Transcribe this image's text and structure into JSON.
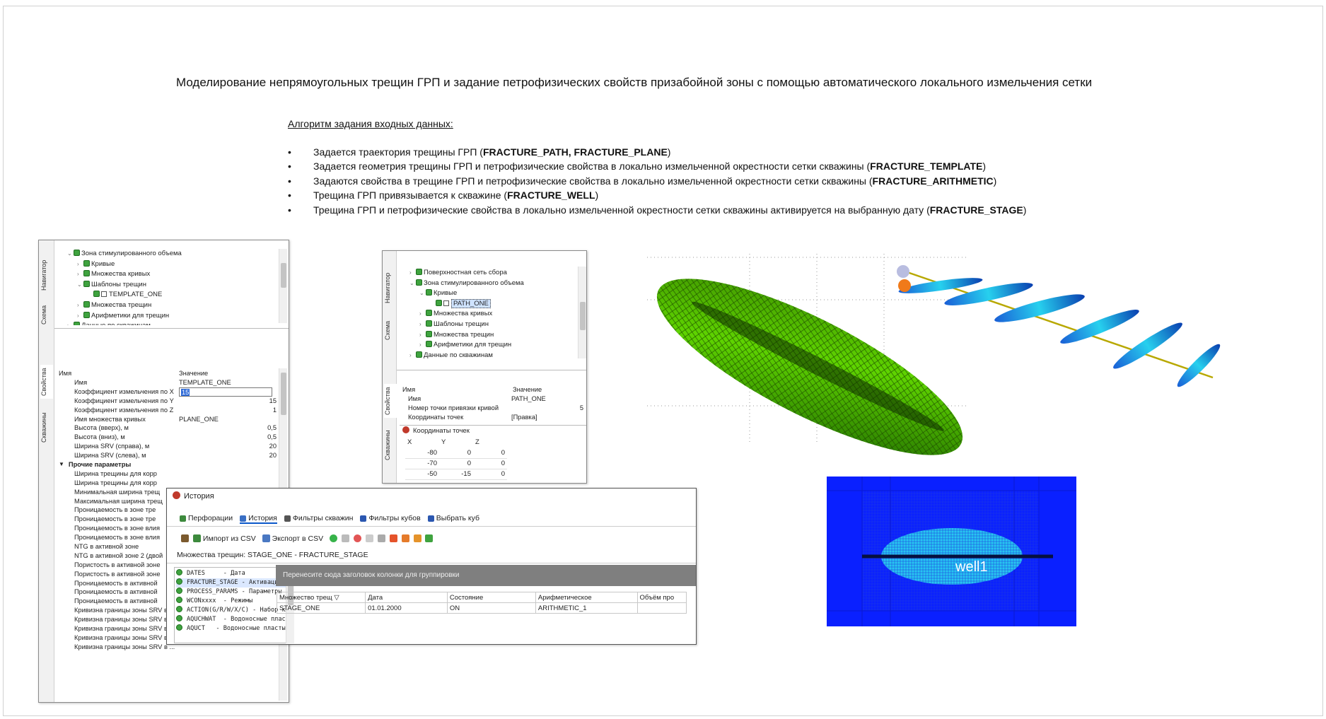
{
  "header": {
    "title": "Моделирование непрямоугольных трещин ГРП и задание петрофизических свойств призабойной зоны с помощью автоматического локального измельчения сетки",
    "algo_title": "Алгоритм задания входных данных:",
    "bullets": [
      {
        "text": "Задается траектория трещины ГРП (",
        "bold": "FRACTURE_PATH, FRACTURE_PLANE",
        "end": ")"
      },
      {
        "text": "Задается геометрия трещины ГРП и петрофизические свойства в локально измельченной окрестности сетки скважины  (",
        "bold": "FRACTURE_TEMPLATE",
        "end": ")"
      },
      {
        "text": "Задаются свойства в трещине ГРП и петрофизические свойства в локально измельченной окрестности сетки скважины  (",
        "bold": "FRACTURE_ARITHMETIC",
        "end": ")"
      },
      {
        "text": "Трещина ГРП привязывается к скважине (",
        "bold": "FRACTURE_WELL",
        "end": ")"
      },
      {
        "text": "Трещина ГРП и петрофизические свойства в локально измельченной окрестности сетки скважины активируется на выбранную дату (",
        "bold": "FRACTURE_STAGE",
        "end": ")"
      }
    ]
  },
  "win1": {
    "tabs": {
      "navigator": "Навигатор",
      "schema": "Схема",
      "props": "Свойства",
      "wells": "Скважины"
    },
    "tree": [
      {
        "label": "Зона стимулированного объема",
        "level": 0,
        "arrow": "⌄"
      },
      {
        "label": "Кривые",
        "level": 1,
        "arrow": "›"
      },
      {
        "label": "Множества кривых",
        "level": 1,
        "arrow": "›"
      },
      {
        "label": "Шаблоны трещин",
        "level": 1,
        "arrow": "⌄"
      },
      {
        "label": "TEMPLATE_ONE",
        "level": 2,
        "arrow": "",
        "check": true
      },
      {
        "label": "Множества трещин",
        "level": 1,
        "arrow": "›"
      },
      {
        "label": "Арифметики для трещин",
        "level": 1,
        "arrow": "›"
      },
      {
        "label": "Данные по скважинам",
        "level": 0,
        "arrow": "›"
      }
    ],
    "col_name": "Имя",
    "col_value": "Значение",
    "props": [
      {
        "n": "Имя",
        "v": "TEMPLATE_ONE",
        "r": false
      },
      {
        "n": "Коэффициент измельчения по X",
        "v": "15",
        "r": false,
        "edit": true
      },
      {
        "n": "Коэффициент измельчения по Y",
        "v": "15",
        "r": true
      },
      {
        "n": "Коэффициент измельчения по Z",
        "v": "1",
        "r": true
      },
      {
        "n": "Имя множества кривых",
        "v": "PLANE_ONE",
        "r": false
      },
      {
        "n": "Высота (вверх), м",
        "v": "0,5",
        "r": true
      },
      {
        "n": "Высота (вниз), м",
        "v": "0,5",
        "r": true
      },
      {
        "n": "Ширина SRV (справа), м",
        "v": "20",
        "r": true
      },
      {
        "n": "Ширина SRV (слева), м",
        "v": "20",
        "r": true
      }
    ],
    "group_label": "Прочие параметры",
    "other": [
      "Ширина трещины для корр",
      "Ширина трещины для корр",
      "Минимальная ширина трещ",
      "Максимальная ширина трещ",
      "Проницаемость в зоне тре",
      "Проницаемость в зоне тре",
      "Проницаемость в зоне влия",
      "Проницаемость в зоне влия",
      "NTG в активной зоне",
      "NTG в активной зоне 2 (двой",
      "Пористость в активной зоне",
      "Пористость в активной зоне",
      "Проницаемость в активной",
      "Проницаемость в активной",
      "Проницаемость в активной",
      "Кривизна границы зоны SRV в ...",
      "Кривизна границы зоны SRV в ...",
      "Кривизна границы зоны SRV в ...",
      "Кривизна границы зоны SRV в ...",
      "Кривизна границы зоны SRV в ..."
    ]
  },
  "win2": {
    "tabs": {
      "navigator": "Навигатор",
      "schema": "Схема",
      "props": "Свойства",
      "wells": "Скважины"
    },
    "tree": [
      {
        "label": "Поверхностная сеть сбора",
        "level": 0,
        "arrow": "›"
      },
      {
        "label": "Зона стимулированного объема",
        "level": 0,
        "arrow": "⌄"
      },
      {
        "label": "Кривые",
        "level": 1,
        "arrow": "⌄"
      },
      {
        "label": "PATH_ONE",
        "level": 2,
        "arrow": "",
        "check": true,
        "sel": true
      },
      {
        "label": "Множества кривых",
        "level": 1,
        "arrow": "›"
      },
      {
        "label": "Шаблоны трещин",
        "level": 1,
        "arrow": "›"
      },
      {
        "label": "Множества трещин",
        "level": 1,
        "arrow": "›"
      },
      {
        "label": "Арифметики для трещин",
        "level": 1,
        "arrow": "›"
      },
      {
        "label": "Данные по скважинам",
        "level": 0,
        "arrow": "›"
      }
    ],
    "col_name": "Имя",
    "col_value": "Значение",
    "props": [
      {
        "n": "Имя",
        "v": "PATH_ONE",
        "r": false
      },
      {
        "n": "Номер точки привязки кривой",
        "v": "5",
        "r": true
      },
      {
        "n": "Координаты точек",
        "v": "[Правка]",
        "r": false
      }
    ],
    "coords_title": "Координаты точек",
    "coords_head": [
      "X",
      "Y",
      "Z"
    ],
    "coords": [
      [
        "-80",
        "0",
        "0"
      ],
      [
        "-70",
        "0",
        "0"
      ],
      [
        "-50",
        "-15",
        "0"
      ]
    ]
  },
  "win3": {
    "title": "История",
    "tabs": [
      "Перфорации",
      "История",
      "Фильтры скважин",
      "Фильтры кубов",
      "Выбрать куб"
    ],
    "import_label": "Импорт из CSV",
    "export_label": "Экспорт в CSV",
    "breadcrumb": "Множества трещин: STAGE_ONE - FRACTURE_STAGE",
    "keywords": [
      "DATES     - Дата",
      "FRACTURE_STAGE - Активация множ",
      "PROCESS_PARAMS - Параметры расч",
      "WCONxxxx  - Режимы",
      "ACTION(G/R/W/X/C) - Набор ключе",
      "AQUCHWAT  - Водоносные пласты по",
      "AQUCT   - Водоносные пласты Ка"
    ],
    "group_hint": "Перенесите сюда заголовок колонки для группировки",
    "columns": [
      "Множество трещ",
      "Дата",
      "Состояние",
      "Арифметическое",
      "Объём про"
    ],
    "rows": [
      [
        "STAGE_ONE",
        "01.01.2000",
        "ON",
        "ARITHMETIC_1",
        ""
      ]
    ]
  },
  "grid_view": {
    "well_label": "well1"
  },
  "colors": {
    "accent": "#0a58ca",
    "green": "#3fa33f",
    "blue_bg": "#0030ff",
    "cyan": "#27c7f0",
    "selection": "#cfe3ff"
  }
}
